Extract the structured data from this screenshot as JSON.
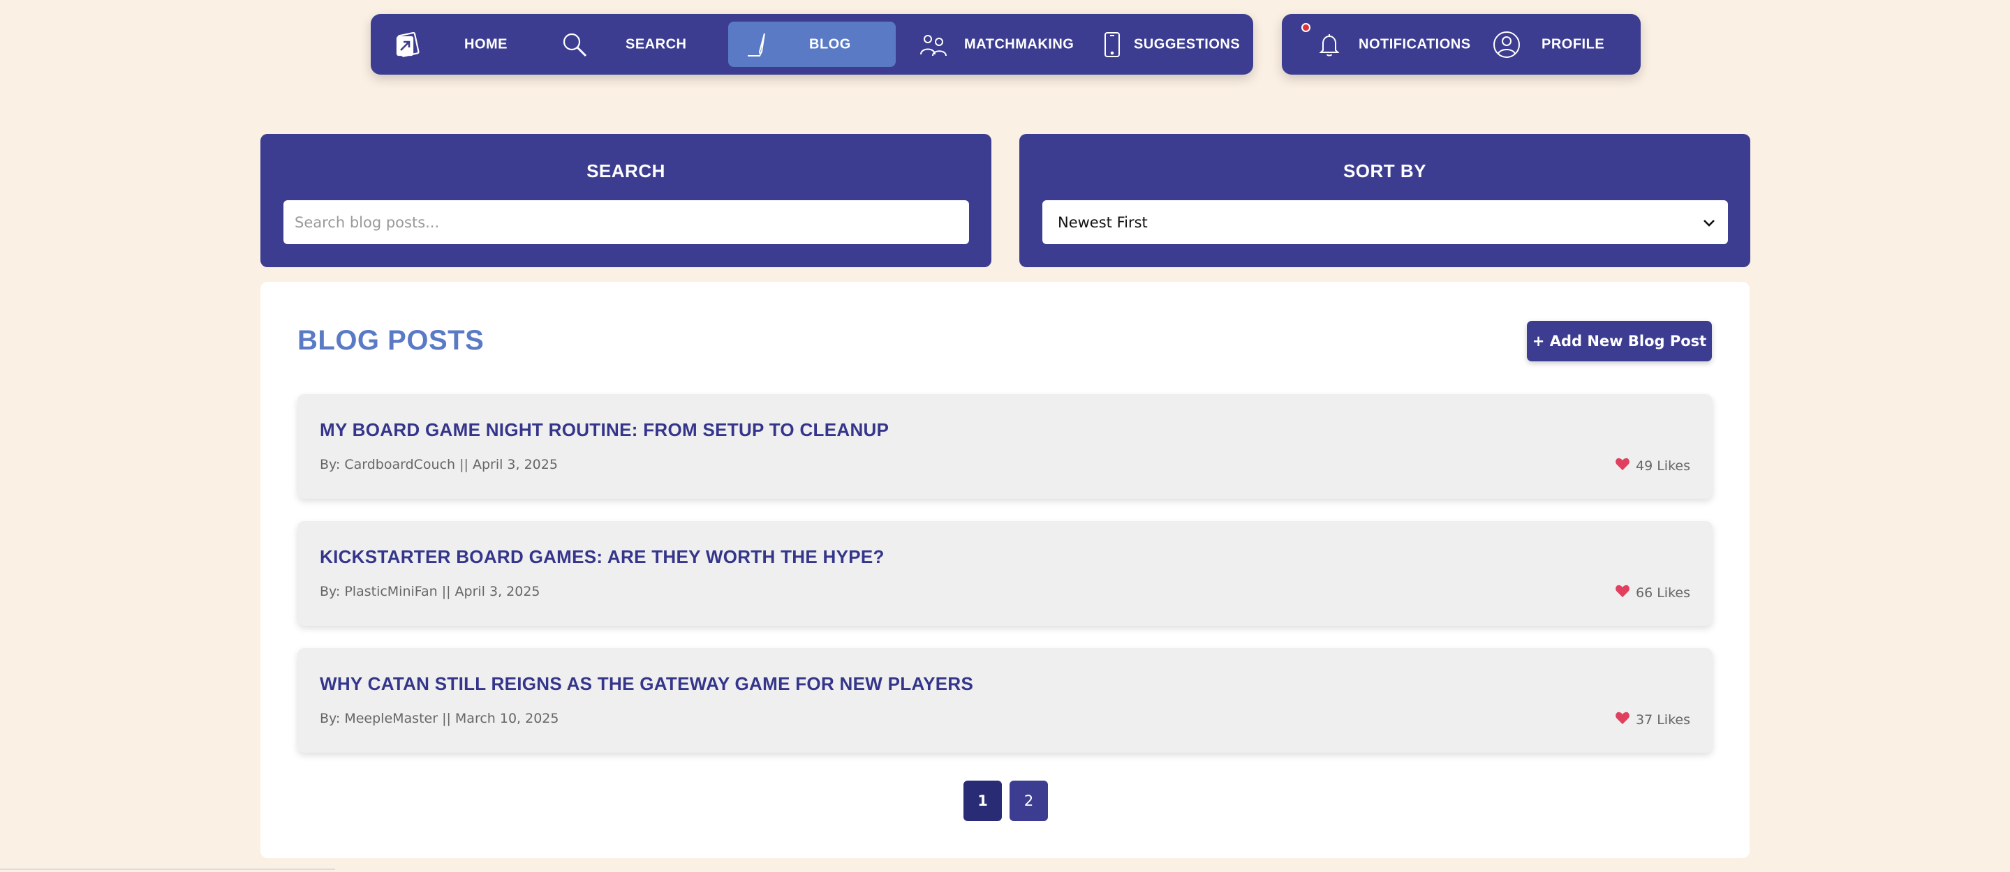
{
  "nav": {
    "items": [
      {
        "id": "home",
        "label": "HOME",
        "icon": "card-icon",
        "active": false
      },
      {
        "id": "search",
        "label": "SEARCH",
        "icon": "magnifier-icon",
        "active": false
      },
      {
        "id": "blog",
        "label": "BLOG",
        "icon": "pen-icon",
        "active": true
      },
      {
        "id": "matchmaking",
        "label": "MATCHMAKING",
        "icon": "people-icon",
        "active": false
      },
      {
        "id": "suggestions",
        "label": "SUGGESTIONS",
        "icon": "phone-icon",
        "active": false
      }
    ],
    "side_items": [
      {
        "id": "notifications",
        "label": "NOTIFICATIONS",
        "icon": "bell-icon",
        "has_unread": true
      },
      {
        "id": "profile",
        "label": "PROFILE",
        "icon": "user-icon"
      }
    ]
  },
  "search_panel": {
    "title": "SEARCH",
    "placeholder": "Search blog posts...",
    "value": ""
  },
  "sort_panel": {
    "title": "SORT BY",
    "selected": "Newest First"
  },
  "blog": {
    "heading": "BLOG POSTS",
    "add_button": "+ Add New Blog Post",
    "posts": [
      {
        "title": "MY BOARD GAME NIGHT ROUTINE: FROM SETUP TO CLEANUP",
        "meta": "By: CardboardCouch || April 3, 2025",
        "likes": "49 Likes"
      },
      {
        "title": "KICKSTARTER BOARD GAMES: ARE THEY WORTH THE HYPE?",
        "meta": "By: PlasticMiniFan || April 3, 2025",
        "likes": "66 Likes"
      },
      {
        "title": "WHY CATAN STILL REIGNS AS THE GATEWAY GAME FOR NEW PLAYERS",
        "meta": "By: MeepleMaster || March 10, 2025",
        "likes": "37 Likes"
      }
    ],
    "pagination": {
      "current": "1",
      "pages": [
        "1",
        "2"
      ]
    }
  },
  "colors": {
    "background": "#fbf0e4",
    "primary": "#3c3d91",
    "accent": "#5a7ac6",
    "heart": "#e0405e"
  }
}
